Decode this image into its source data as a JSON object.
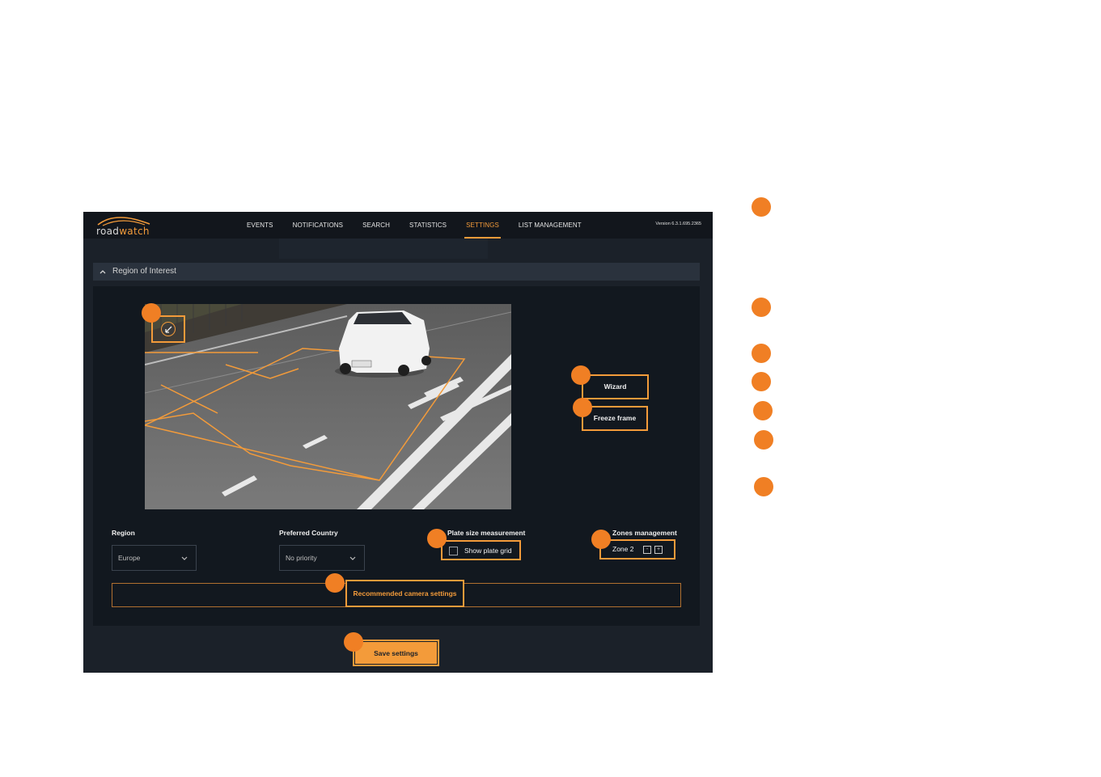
{
  "app": {
    "logo_text_1": "road",
    "logo_text_2": "watch",
    "version": "Version 6.3.1.695.2365"
  },
  "nav": {
    "items": [
      {
        "label": "EVENTS"
      },
      {
        "label": "NOTIFICATIONS"
      },
      {
        "label": "SEARCH"
      },
      {
        "label": "STATISTICS"
      },
      {
        "label": "SETTINGS"
      },
      {
        "label": "LIST MANAGEMENT"
      }
    ],
    "active": "SETTINGS"
  },
  "section": {
    "title": "Region of Interest"
  },
  "camera": {
    "expand_icon": "expand-arrow-icon"
  },
  "buttons": {
    "wizard": "Wizard",
    "freeze_frame": "Freeze frame",
    "recommended": "Recommended camera settings",
    "save": "Save settings"
  },
  "fields": {
    "region": {
      "label": "Region",
      "value": "Europe"
    },
    "preferred_country": {
      "label": "Preferred Country",
      "value": "No priority"
    },
    "plate_size": {
      "label": "Plate size measurement",
      "checkbox_label": "Show plate grid",
      "checked": false
    },
    "zones": {
      "label": "Zones management",
      "zone_value": "Zone 2",
      "minus": "-",
      "plus": "+"
    }
  },
  "colors": {
    "accent": "#f39b3a",
    "marker": "#f07f24",
    "app_bg": "#1b2129",
    "panel_bg": "#12181f"
  }
}
